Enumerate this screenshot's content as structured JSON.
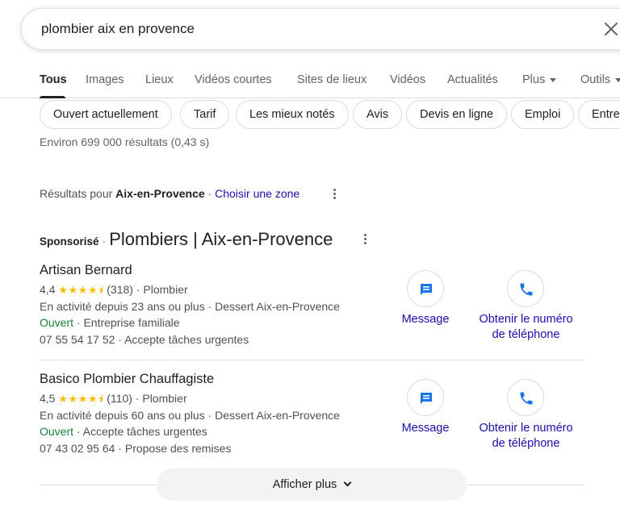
{
  "search": {
    "query": "plombier aix en provence"
  },
  "tabs": [
    {
      "label": "Tous"
    },
    {
      "label": "Images"
    },
    {
      "label": "Lieux"
    },
    {
      "label": "Vidéos courtes"
    },
    {
      "label": "Sites de lieux"
    },
    {
      "label": "Vidéos"
    },
    {
      "label": "Actualités"
    },
    {
      "label": "Plus"
    },
    {
      "label": "Outils"
    }
  ],
  "chips": [
    {
      "label": "Ouvert actuellement"
    },
    {
      "label": "Tarif"
    },
    {
      "label": "Les mieux notés"
    },
    {
      "label": "Avis"
    },
    {
      "label": "Devis en ligne"
    },
    {
      "label": "Emploi"
    },
    {
      "label": "Entre"
    }
  ],
  "stats": "Environ 699 000 résultats (0,43 s)",
  "location": {
    "prefix": "Résultats pour",
    "place": "Aix-en-Provence",
    "sep": " · ",
    "change": "Choisir une zone"
  },
  "sponsored": {
    "tag": "Sponsorisé",
    "sep": "·",
    "title": "Plombiers | Aix-en-Provence"
  },
  "listings": [
    {
      "name": "Artisan Bernard",
      "rating": "4,4",
      "stars": "★★★★⯨",
      "reviews": "(318)",
      "category": " · Plombier",
      "years": "En activité depuis 23 ans ou plus · Dessert Aix-en-Provence",
      "open": "Ouvert",
      "open_extra": " · Entreprise familiale",
      "phone": "07 55 54 17 52 · Accepte tâches urgentes",
      "msg_label": "Message",
      "call_label_1": "Obtenir le numéro",
      "call_label_2": "de téléphone"
    },
    {
      "name": "Basico Plombier Chauffagiste",
      "rating": "4,5",
      "stars": "★★★★⯨",
      "reviews": "(110)",
      "category": " · Plombier",
      "years": "En activité depuis 60 ans ou plus · Dessert Aix-en-Provence",
      "open": "Ouvert",
      "open_extra": " · Accepte tâches urgentes",
      "phone": "07 43 02 95 64 · Propose des remises",
      "msg_label": "Message",
      "call_label_1": "Obtenir le numéro",
      "call_label_2": "de téléphone"
    }
  ],
  "more": {
    "label": "Afficher plus"
  },
  "colors": {
    "link": "#1a0dab",
    "open": "#188038",
    "star": "#fbbc04",
    "icon_blue": "#1a73e8"
  },
  "icons": {
    "clear": "close-icon",
    "message": "message-icon",
    "call": "phone-icon"
  }
}
